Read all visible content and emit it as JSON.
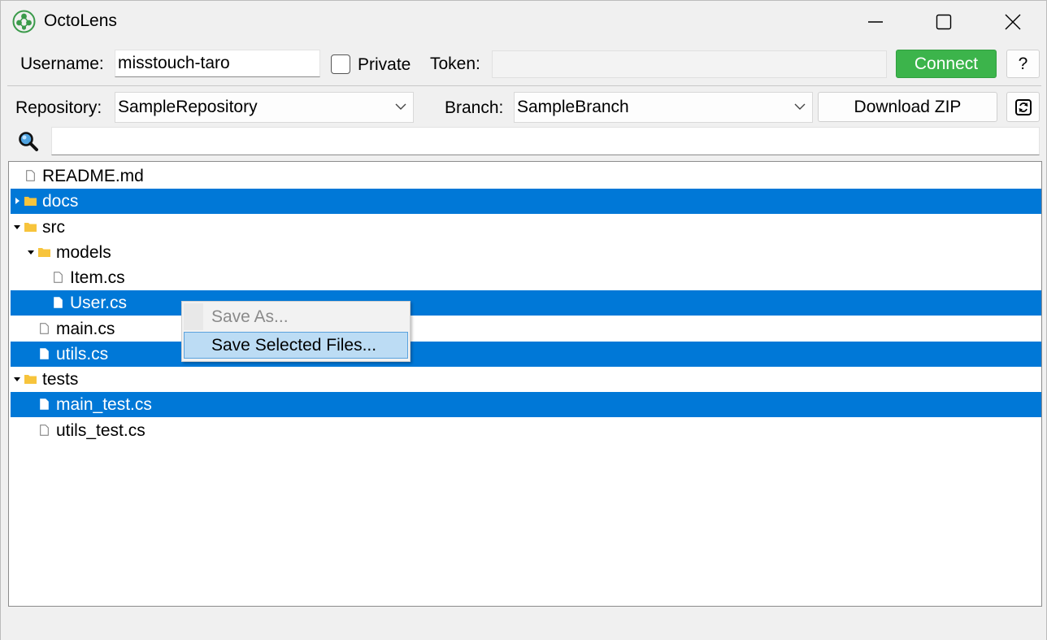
{
  "window": {
    "title": "OctoLens"
  },
  "auth": {
    "username_label": "Username:",
    "username_value": "misstouch-taro",
    "private_label": "Private",
    "private_checked": false,
    "token_label": "Token:",
    "token_value": "",
    "connect_label": "Connect",
    "help_label": "?"
  },
  "repo": {
    "repository_label": "Repository:",
    "repository_value": "SampleRepository",
    "branch_label": "Branch:",
    "branch_value": "SampleBranch",
    "download_label": "Download ZIP"
  },
  "search": {
    "value": ""
  },
  "tree": {
    "items": [
      {
        "label": "README.md",
        "kind": "file",
        "depth": 0,
        "selected": false
      },
      {
        "label": "docs",
        "kind": "folder",
        "depth": 0,
        "expanded": false,
        "selected": true
      },
      {
        "label": "src",
        "kind": "folder",
        "depth": 0,
        "expanded": true,
        "selected": false
      },
      {
        "label": "models",
        "kind": "folder",
        "depth": 1,
        "expanded": true,
        "selected": false
      },
      {
        "label": "Item.cs",
        "kind": "file",
        "depth": 2,
        "selected": false
      },
      {
        "label": "User.cs",
        "kind": "file",
        "depth": 2,
        "selected": true
      },
      {
        "label": "main.cs",
        "kind": "file",
        "depth": 1,
        "selected": false
      },
      {
        "label": "utils.cs",
        "kind": "file",
        "depth": 1,
        "selected": true
      },
      {
        "label": "tests",
        "kind": "folder",
        "depth": 0,
        "expanded": true,
        "selected": false
      },
      {
        "label": "main_test.cs",
        "kind": "file",
        "depth": 1,
        "selected": true
      },
      {
        "label": "utils_test.cs",
        "kind": "file",
        "depth": 1,
        "selected": false
      }
    ]
  },
  "context_menu": {
    "items": [
      {
        "label": "Save As...",
        "enabled": false
      },
      {
        "label": "Save Selected Files...",
        "enabled": true,
        "highlighted": true
      }
    ]
  },
  "colors": {
    "selection": "#0078d7",
    "connect": "#3cb44b",
    "folder": "#f7c43c",
    "menu_highlight": "#bcdcf4"
  },
  "icons": [
    "app-logo-icon",
    "minimize-icon",
    "maximize-icon",
    "close-icon",
    "chevron-down-icon",
    "refresh-icon",
    "search-icon",
    "folder-icon",
    "file-icon",
    "expand-arrow-icon",
    "collapse-arrow-icon"
  ]
}
